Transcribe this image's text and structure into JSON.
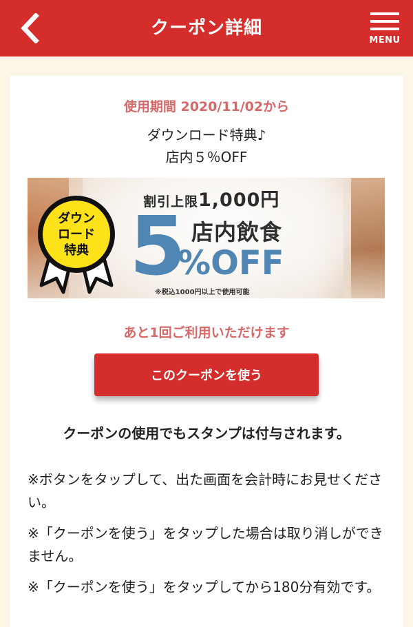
{
  "header": {
    "title": "クーポン詳細",
    "menu_label": "MENU",
    "back_icon": "chevron-left-icon",
    "menu_icon": "hamburger-icon",
    "color": "#d42d2b"
  },
  "coupon": {
    "period": "使用期間 2020/11/02から",
    "title_line1": "ダウンロード特典♪",
    "title_line2": "店内５％OFF",
    "banner": {
      "badge_line1": "ダウン",
      "badge_line2": "ロード",
      "badge_line3": "特典",
      "limit_prefix": "割引上限",
      "limit_amount": "1,000円",
      "dine_in": "店内飲食",
      "discount_number": "5",
      "discount_suffix": "%OFF",
      "note": "※税込1000円以上で使用可能"
    },
    "remaining": "あと1回ご利用いただけます",
    "use_button": "このクーポンを使う",
    "stamp_note": "クーポンの使用でもスタンプは付与されます。",
    "notes": [
      "※ボタンをタップして、出た画面を会計時にお見せください。",
      "※「クーポンを使う」をタップした場合は取り消しができません。",
      "※「クーポンを使う」をタップしてから180分有効です。"
    ]
  },
  "colors": {
    "accent": "#d42d2b",
    "pink_text": "#d56868",
    "discount_blue": "#4f86b4",
    "page_bg": "#fbf6e5"
  }
}
